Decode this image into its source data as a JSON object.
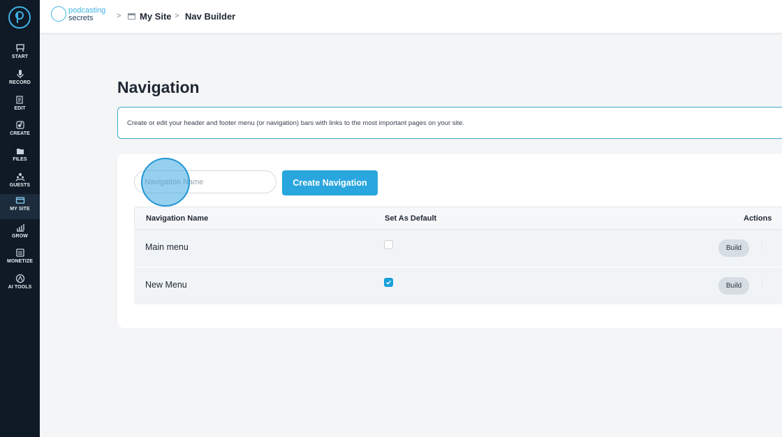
{
  "colors": {
    "accent": "#2aa6df",
    "sidebar_bg": "#0f1a26",
    "checkbox_on": "#1a9fd9"
  },
  "sidebar": {
    "items": [
      {
        "label": "START",
        "icon": "start-icon",
        "active": false
      },
      {
        "label": "RECORD",
        "icon": "microphone-icon",
        "active": false
      },
      {
        "label": "EDIT",
        "icon": "edit-icon",
        "active": false
      },
      {
        "label": "CREATE",
        "icon": "create-icon",
        "active": false
      },
      {
        "label": "FILES",
        "icon": "files-icon",
        "active": false
      },
      {
        "label": "GUESTS",
        "icon": "guests-icon",
        "active": false
      },
      {
        "label": "MY SITE",
        "icon": "my-site-icon",
        "active": true
      },
      {
        "label": "GROW",
        "icon": "grow-icon",
        "active": false
      },
      {
        "label": "MONETIZE",
        "icon": "monetize-icon",
        "active": false
      },
      {
        "label": "AI TOOLS",
        "icon": "ai-tools-icon",
        "active": false
      }
    ]
  },
  "header": {
    "brand_line1": "podcasting",
    "brand_line2": "secrets",
    "breadcrumb": [
      "My Site",
      "Nav Builder"
    ],
    "separator": ">"
  },
  "main": {
    "title": "Navigation",
    "info": "Create or edit your header and footer menu (or navigation) bars with links to the most important pages on your site.",
    "input_placeholder": "Navigation Name",
    "create_button": "Create Navigation",
    "table": {
      "headers": [
        "Navigation Name",
        "Set As Default",
        "Actions"
      ],
      "rows": [
        {
          "name": "Main menu",
          "default": false,
          "action": "Build"
        },
        {
          "name": "New Menu",
          "default": true,
          "action": "Build"
        }
      ]
    }
  }
}
